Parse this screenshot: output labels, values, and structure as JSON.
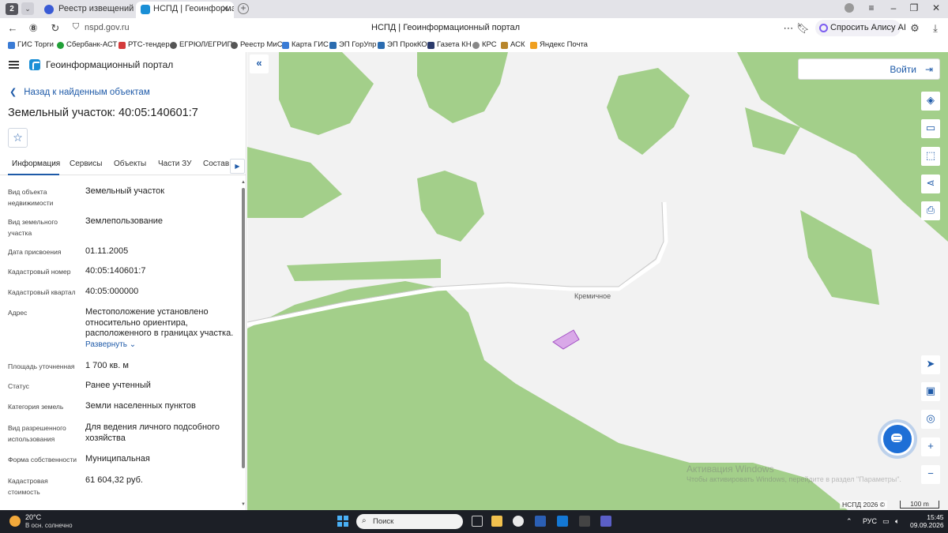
{
  "browser": {
    "tab_count": "2",
    "tabs": [
      {
        "label": "Реестр извещений"
      },
      {
        "label": "НСПД | Геоинформацио"
      }
    ],
    "url": "nspd.gov.ru",
    "page_title": "НСПД | Геоинформационный портал",
    "alice_label": "Спросить Алису AI",
    "bookmarks": [
      {
        "label": "ГИС Торги",
        "color": "#3a7bd5"
      },
      {
        "label": "Сбербанк-АСТ",
        "color": "#21a038"
      },
      {
        "label": "РТС-тендер",
        "color": "#d43b3b"
      },
      {
        "label": "ЕГРЮЛ/ЕГРИП",
        "color": "#555555"
      },
      {
        "label": "Реестр МиС",
        "color": "#555555"
      },
      {
        "label": "Карта ГИС",
        "color": "#3a7bd5"
      },
      {
        "label": "ЭП ГорУпр",
        "color": "#2b6cb0"
      },
      {
        "label": "ЭП ПрокКО",
        "color": "#2b6cb0"
      },
      {
        "label": "Газета КН",
        "color": "#2b3a6b"
      },
      {
        "label": "КРС",
        "color": "#888888"
      },
      {
        "label": "АСК",
        "color": "#b8862b"
      },
      {
        "label": "Яндекс Почта",
        "color": "#f0a020"
      }
    ]
  },
  "panel": {
    "portal_name": "Геоинформационный портал",
    "back_label": "Назад к найденным объектам",
    "title": "Земельный участок: 40:05:140601:7",
    "tabs": [
      "Информация",
      "Сервисы",
      "Объекты",
      "Части ЗУ",
      "Состав"
    ],
    "rows": [
      {
        "label": "Вид объекта недвижимости",
        "value": "Земельный участок"
      },
      {
        "label": "Вид земельного участка",
        "value": "Землепользование"
      },
      {
        "label": "Дата присвоения",
        "value": "01.11.2005"
      },
      {
        "label": "Кадастровый номер",
        "value": "40:05:140601:7"
      },
      {
        "label": "Кадастровый квартал",
        "value": "40:05:000000"
      },
      {
        "label": "Адрес",
        "value": "Местоположение установлено относительно ориентира, расположенного в границах участка.",
        "expand": "Развернуть"
      },
      {
        "label": "Площадь уточненная",
        "value": "1 700 кв. м"
      },
      {
        "label": "Статус",
        "value": "Ранее учтенный"
      },
      {
        "label": "Категория земель",
        "value": "Земли населенных пунктов"
      },
      {
        "label": "Вид разрешенного использования",
        "value": "Для ведения личного подсобного хозяйства"
      },
      {
        "label": "Форма собственности",
        "value": "Муниципальная"
      },
      {
        "label": "Кадастровая стоимость",
        "value": "61 604,32 руб."
      }
    ]
  },
  "map": {
    "login_label": "Войти",
    "place_label": "Кремичное",
    "copyright": "НСПД 2026 ©",
    "scale_label": "100 m",
    "watermark_title": "Активация Windows",
    "watermark_text": "Чтобы активировать Windows, перейдите в раздел \"Параметры\".",
    "colors": {
      "forest": "#a3cf8a",
      "open": "#f2f2f2",
      "parcel": "#d9a8e8",
      "accent": "#1e5aa8"
    }
  },
  "taskbar": {
    "temperature": "20°C",
    "weather": "В осн. солнечно",
    "search_label": "Поиск",
    "lang": "РУС",
    "time": "15:45",
    "date": "09.09.2026"
  }
}
